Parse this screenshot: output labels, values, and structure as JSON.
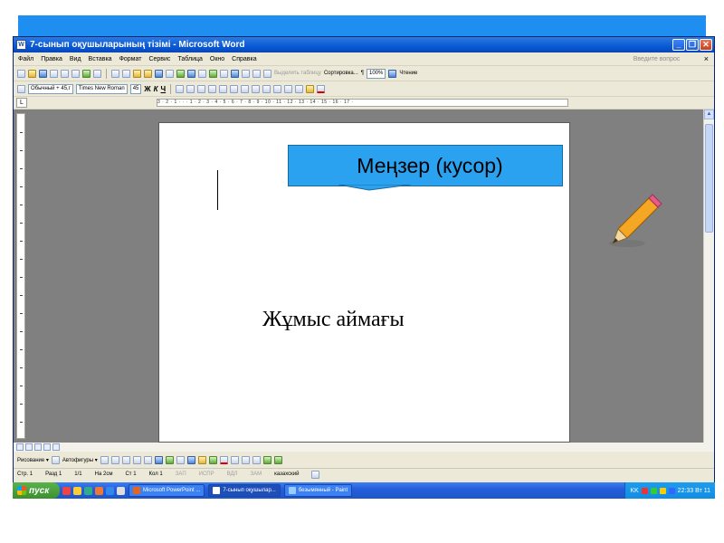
{
  "window": {
    "title": "7-сынып оқушыларының тізімі - Microsoft Word"
  },
  "menu": {
    "items": [
      "Файл",
      "Правка",
      "Вид",
      "Вставка",
      "Формат",
      "Сервис",
      "Таблица",
      "Окно",
      "Справка"
    ],
    "help_placeholder": "Введите вопрос",
    "close_doc": "×"
  },
  "toolbar_standard": {
    "table_text": "Выделить таблицу",
    "sort_label": "Сортировка...",
    "pilcrow": "¶",
    "zoom": "100%",
    "reading_label": "Чтение"
  },
  "toolbar_format": {
    "style": "Обычный + 45,г",
    "font": "Times New Roman",
    "size": "45",
    "bold": "Ж",
    "italic": "К",
    "underline": "Ч"
  },
  "ruler": {
    "corner": "L",
    "marks": "3 · 2 · 1 · · · 1 · 2 · 3 · 4 · 5 · 6 · 7 · 8 · 9 · 10 · 11 · 12 · 13 · 14 · 15 · 16 · 17 ·"
  },
  "document": {
    "callout_text": "Меңзер (кусор)",
    "work_area_label": "Жұмыс аймағы"
  },
  "draw_toolbar": {
    "draw_label": "Рисование ▾",
    "autoshapes_label": "Автофигуры ▾"
  },
  "status": {
    "page": "Стр. 1",
    "section": "Разд 1",
    "pages": "1/1",
    "at": "На 2см",
    "line": "Ст 1",
    "col": "Кол 1",
    "rec": "ЗАП",
    "trk": "ИСПР",
    "ext": "ВДЛ",
    "ovr": "ЗАМ",
    "language": "казахский"
  },
  "taskbar": {
    "start_label": "пуск",
    "tasks": [
      "Microsoft PowerPoint ...",
      "7-сынып оқушылар...",
      "безымянный - Paint"
    ],
    "lang": "KK",
    "clock": "22:33 Вт 11"
  },
  "colors": {
    "slide_band": "#1e8ef0",
    "callout": "#2aa2f0",
    "workspace": "#808080"
  }
}
